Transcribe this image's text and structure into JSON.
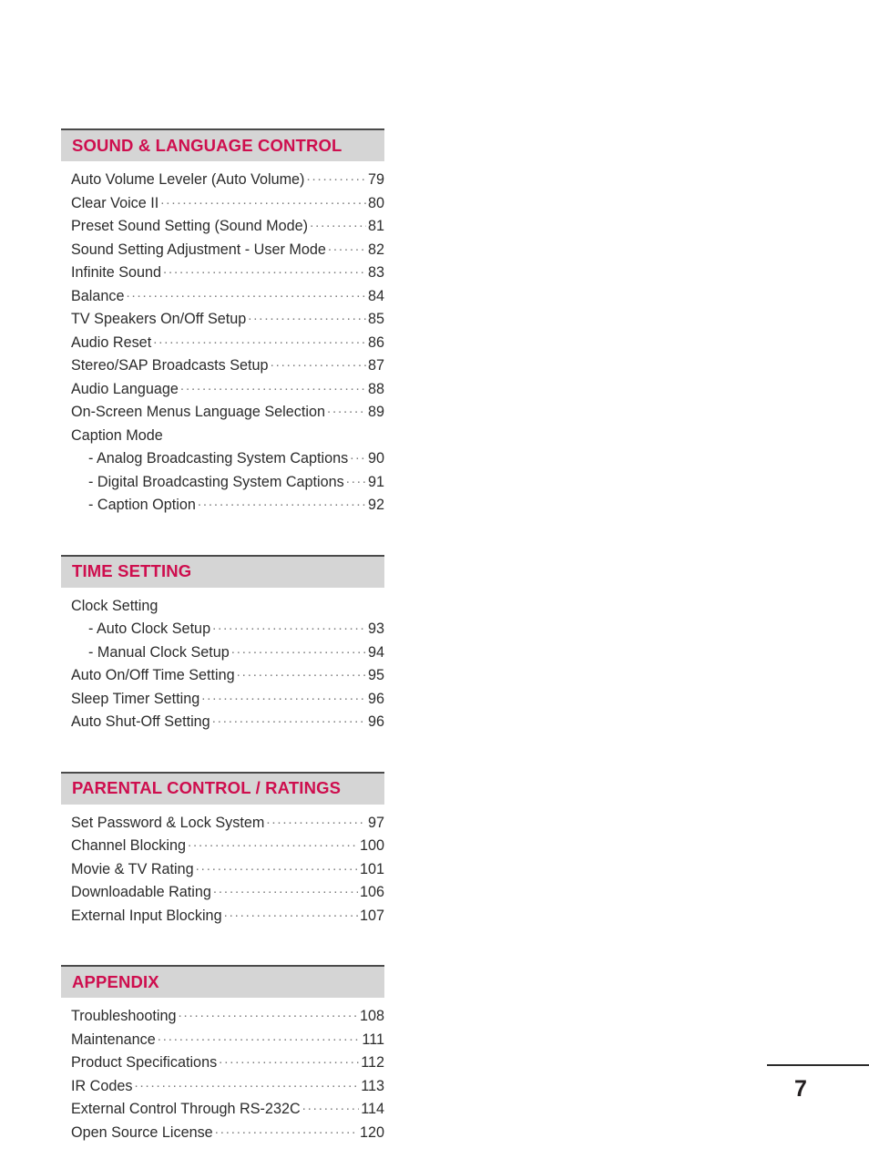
{
  "page": {
    "number": "7",
    "accent_color": "#ce0e4e",
    "header_band_color": "#d5d5d5",
    "rule_color": "#4a4a4a"
  },
  "sections": [
    {
      "title": "SOUND & LANGUAGE CONTROL",
      "entries": [
        {
          "label": "Auto Volume Leveler (Auto Volume)",
          "page": "79",
          "sub": false
        },
        {
          "label": "Clear Voice II",
          "page": "80",
          "sub": false
        },
        {
          "label": "Preset Sound Setting (Sound Mode)",
          "page": "81",
          "sub": false
        },
        {
          "label": "Sound Setting Adjustment - User Mode",
          "page": "82",
          "sub": false
        },
        {
          "label": "Infinite Sound",
          "page": "83",
          "sub": false
        },
        {
          "label": "Balance",
          "page": "84",
          "sub": false
        },
        {
          "label": "TV Speakers On/Off Setup",
          "page": "85",
          "sub": false
        },
        {
          "label": "Audio Reset",
          "page": "86",
          "sub": false
        },
        {
          "label": "Stereo/SAP Broadcasts Setup",
          "page": "87",
          "sub": false
        },
        {
          "label": "Audio Language",
          "page": "88",
          "sub": false
        },
        {
          "label": "On-Screen Menus Language Selection",
          "page": "89",
          "sub": false
        },
        {
          "label": "Caption Mode",
          "page": "",
          "sub": false
        },
        {
          "label": "- Analog Broadcasting System Captions",
          "page": "90",
          "sub": true
        },
        {
          "label": "- Digital Broadcasting System Captions",
          "page": "91",
          "sub": true
        },
        {
          "label": "- Caption Option",
          "page": "92",
          "sub": true
        }
      ]
    },
    {
      "title": "TIME SETTING",
      "entries": [
        {
          "label": "Clock Setting",
          "page": "",
          "sub": false
        },
        {
          "label": "- Auto Clock Setup",
          "page": "93",
          "sub": true
        },
        {
          "label": "- Manual Clock Setup",
          "page": "94",
          "sub": true
        },
        {
          "label": "Auto On/Off Time Setting",
          "page": "95",
          "sub": false
        },
        {
          "label": "Sleep Timer Setting",
          "page": "96",
          "sub": false
        },
        {
          "label": "Auto Shut-Off Setting",
          "page": "96",
          "sub": false
        }
      ]
    },
    {
      "title": "PARENTAL CONTROL / RATINGS",
      "entries": [
        {
          "label": "Set Password & Lock System",
          "page": "97",
          "sub": false
        },
        {
          "label": "Channel Blocking",
          "page": "100",
          "sub": false
        },
        {
          "label": "Movie & TV Rating",
          "page": "101",
          "sub": false
        },
        {
          "label": "Downloadable Rating",
          "page": "106",
          "sub": false
        },
        {
          "label": "External Input Blocking",
          "page": "107",
          "sub": false
        }
      ]
    },
    {
      "title": "APPENDIX",
      "entries": [
        {
          "label": "Troubleshooting",
          "page": "108",
          "sub": false
        },
        {
          "label": "Maintenance",
          "page": "111",
          "sub": false
        },
        {
          "label": "Product Specifications",
          "page": "112",
          "sub": false
        },
        {
          "label": "IR Codes",
          "page": "113",
          "sub": false
        },
        {
          "label": "External Control Through RS-232C",
          "page": "114",
          "sub": false
        },
        {
          "label": "Open Source License",
          "page": "120",
          "sub": false
        }
      ]
    }
  ]
}
